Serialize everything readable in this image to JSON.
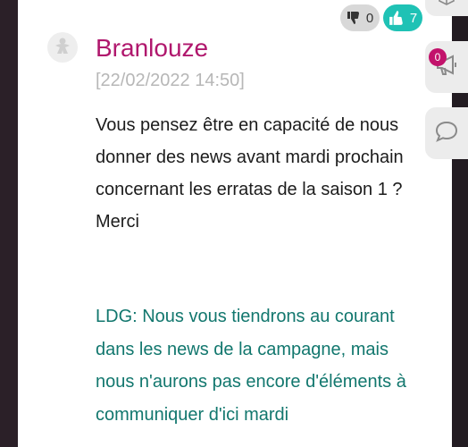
{
  "comment": {
    "author": "Branlouze",
    "date": "[22/02/2022 14:50]",
    "message_lines": [
      "Vous pensez être en capacité de nous",
      "donner des news avant mardi prochain",
      "concernant les erratas de la saison 1 ?",
      "Merci"
    ],
    "reply_lines": [
      "LDG: Nous vous tiendrons au courant",
      "dans les news de la campagne, mais",
      "nous n'aurons pas encore d'éléments à",
      "communiquer d'ici mardi"
    ]
  },
  "votes": {
    "down_count": "0",
    "up_count": "7"
  },
  "sidebar": {
    "news_badge": "0"
  },
  "icons": {
    "vote_down": "thumbs-down-icon",
    "vote_up": "thumbs-up-icon",
    "avatar": "meeple-icon",
    "news": "megaphone-icon",
    "chat": "chat-bubble-icon",
    "top": "box-icon"
  },
  "colors": {
    "author": "#b0176d",
    "reply": "#12776e",
    "vote_up_bg": "#1fc2b5",
    "badge": "#c2126b"
  }
}
